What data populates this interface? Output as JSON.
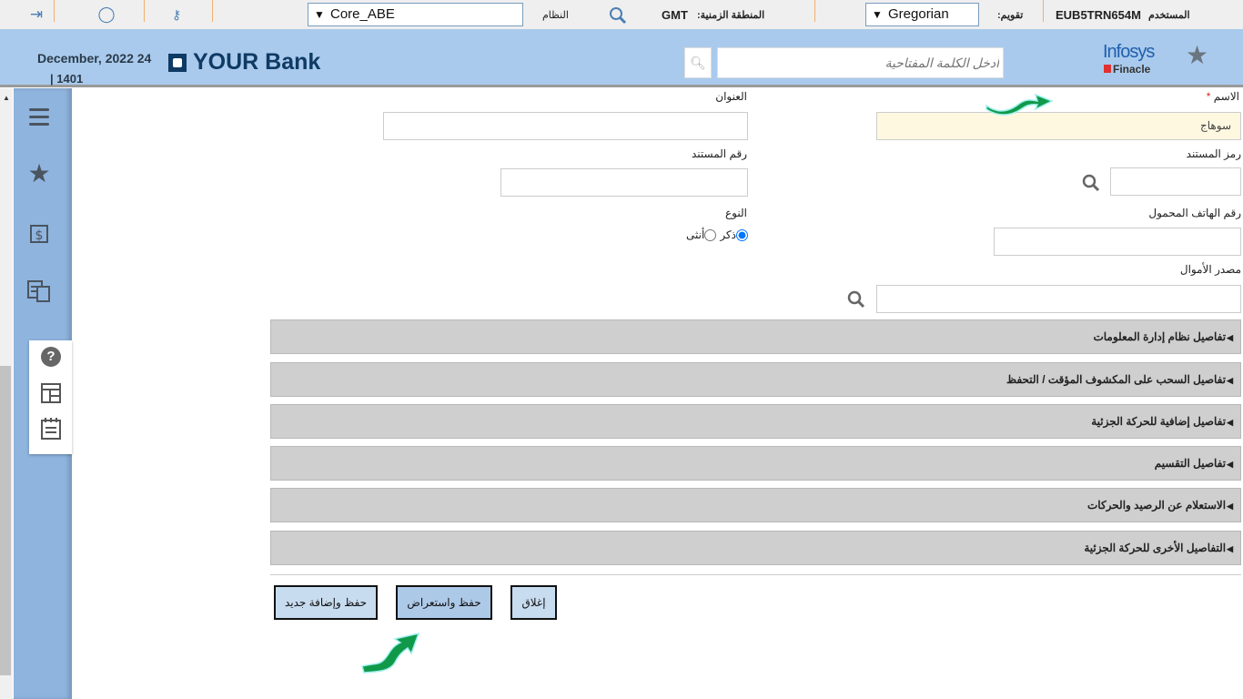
{
  "topbar": {
    "system_select": "Core_ABE",
    "system_label": "النظام",
    "timezone_label": "المنطقة الزمنية:",
    "timezone_value": "GMT",
    "calendar_select": "Gregorian",
    "calendar_label": "تقويم:",
    "user_label": "المستخدم",
    "user_value": "EUB5TRN654M"
  },
  "header": {
    "date": "December, 2022 24",
    "date_hijri": "| 1401",
    "bank_logo": "YOUR Bank",
    "search_placeholder": "أدخل الكلمة المفتاحية",
    "vendor_logo_top": "Infosys",
    "vendor_logo_bottom": "Finacle"
  },
  "form": {
    "name_label": "الاسم",
    "required_mark": "*",
    "name_value": "سوهاج",
    "address_label": "العنوان",
    "doc_code_label": "رمز المستند",
    "doc_number_label": "رقم المستند",
    "mobile_label": "رقم الهاتف المحمول",
    "gender_label": "النوع",
    "gender_options": [
      "ذكر",
      "أنثى"
    ],
    "gender_selected": "ذكر",
    "funds_source_label": "مصدر الأموال"
  },
  "sections": [
    "تفاصيل نظام إدارة المعلومات",
    "تفاصيل السحب على المكشوف المؤقت / التحفظ",
    "تفاصيل إضافية للحركة الجزئية",
    "تفاصيل التقسيم",
    "الاستعلام عن الرصيد والحركات",
    "التفاصيل الأخرى للحركة الجزئية"
  ],
  "buttons": {
    "close": "إغلاق",
    "save_view": "حفظ واستعراض",
    "save_new": "حفظ وإضافة جديد"
  },
  "colors": {
    "header": "#a9caec",
    "sidebar": "#8fb4de",
    "required_field": "#fff8e1",
    "accordion": "#cfcfcf",
    "annotation_arrow": "#11994a"
  }
}
